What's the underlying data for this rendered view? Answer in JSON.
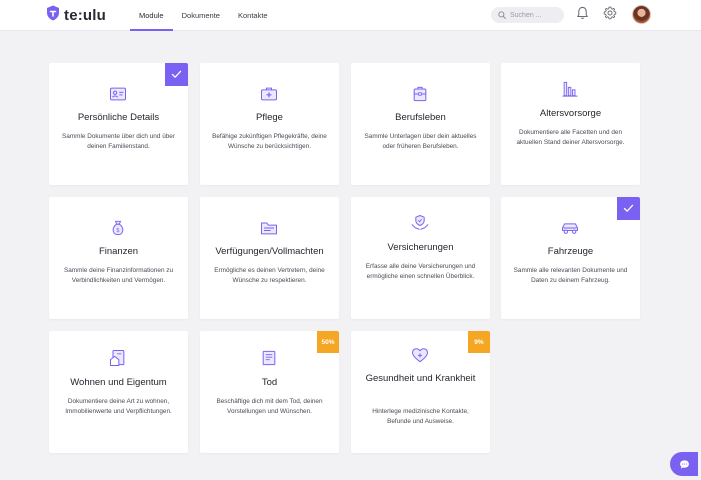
{
  "brand": {
    "name": "te:ulu",
    "accent": "#7b61f2"
  },
  "nav": [
    "Module",
    "Dokumente",
    "Kontakte"
  ],
  "search": {
    "placeholder": "Suchen ..."
  },
  "cards": [
    {
      "title": "Persönliche Details",
      "desc": "Sammle Dokumente über dich und über deinen Familienstand.",
      "icon": "id-card-icon",
      "status": "check"
    },
    {
      "title": "Pflege",
      "desc": "Befähige zukünftigen Pflegekräfte, deine Wünsche zu berücksichtigen.",
      "icon": "first-aid-kit-icon"
    },
    {
      "title": "Berufsleben",
      "desc": "Sammle Unterlagen über dein aktuelles oder früheren Berufsleben.",
      "icon": "briefcase-icon"
    },
    {
      "title": "Altersvorsorge",
      "desc": "Dokumentiere alle Facetten und den aktuellen Stand deiner Altersvorsorge.",
      "icon": "bar-chart-icon"
    },
    {
      "title": "Finanzen",
      "desc": "Sammle deine Finanzinformationen zu Verbindlichkeiten und Vermögen.",
      "icon": "money-bag-icon"
    },
    {
      "title": "Verfügungen/Vollmachten",
      "desc": "Ermögliche es deinen Vertretern, deine Wünsche zu respektieren.",
      "icon": "folder-icon"
    },
    {
      "title": "Versicherungen",
      "desc": "Erfasse alle deine Versicherungen und ermögliche einen schnellen Überblick.",
      "icon": "shield-hands-icon"
    },
    {
      "title": "Fahrzeuge",
      "desc": "Sammle alle relevanten Dokumente und Daten zu deinem Fahrzeug.",
      "icon": "car-icon",
      "status": "check"
    },
    {
      "title": "Wohnen und Eigentum",
      "desc": "Dokumentiere deine Art zu wohnen, Immobilienwerte und Verpflichtungen.",
      "icon": "house-document-icon"
    },
    {
      "title": "Tod",
      "desc": "Beschäftige dich mit dem Tod, deinen Vorstellungen und Wünschen.",
      "icon": "scroll-icon",
      "progress": "50%"
    },
    {
      "title": "Gesundheit und Krankheit",
      "desc": "Hinterlege medizinische Kontakte, Befunde und Ausweise.",
      "icon": "heart-shield-icon",
      "progress": "9%"
    }
  ]
}
